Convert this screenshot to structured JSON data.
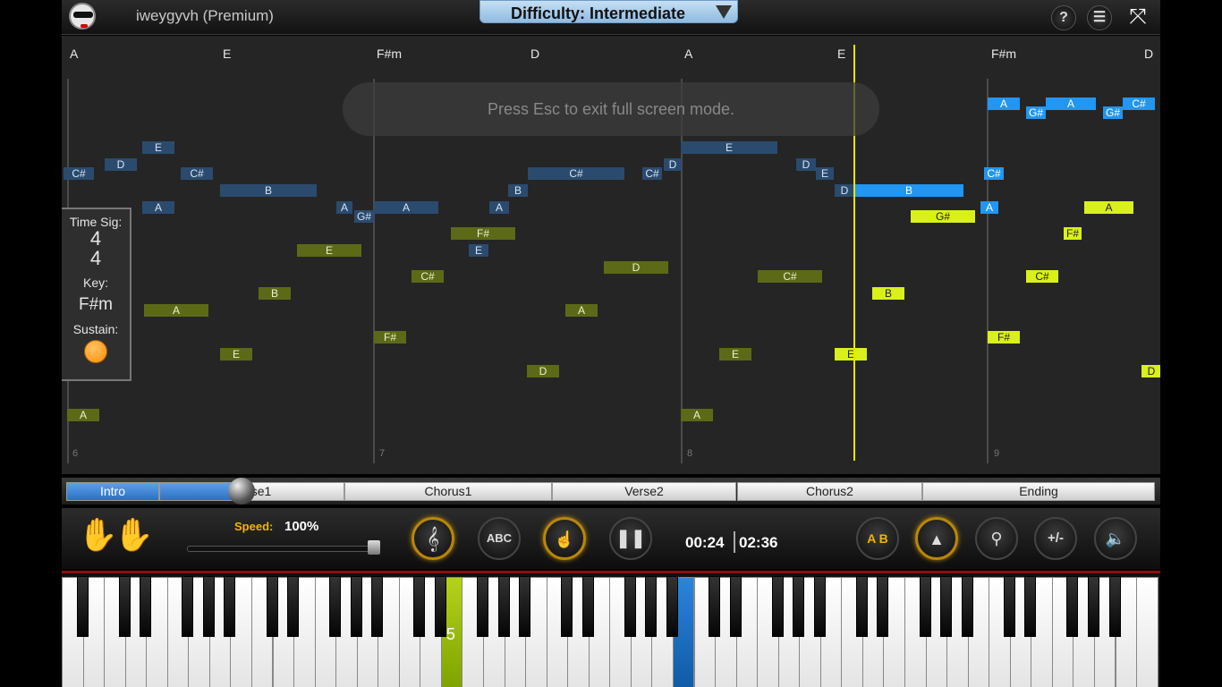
{
  "header": {
    "username": "iweygyvh (Premium)",
    "difficulty": "Difficulty: Intermediate",
    "help_label": "?"
  },
  "score": {
    "chords": [
      "A",
      "E",
      "F#m",
      "D",
      "A",
      "E",
      "F#m",
      "D"
    ],
    "bar_numbers": [
      "6",
      "7",
      "8",
      "9"
    ],
    "fullscreen_message": "Press Esc to exit full screen mode.",
    "notes": [
      "C#",
      "D",
      "E",
      "C#",
      "A",
      "B",
      "A",
      "G#",
      "A",
      "F#",
      "E",
      "A",
      "B",
      "C#",
      "D",
      "E",
      "C#",
      "D",
      "E",
      "D",
      "C#",
      "B",
      "G#",
      "A",
      "C#",
      "A",
      "G#",
      "A",
      "G#",
      "A",
      "F#",
      "C#",
      "B",
      "E",
      "D",
      "E",
      "A",
      "A",
      "E",
      "D",
      "F#",
      "E",
      "A",
      "B",
      "C#",
      "E",
      "D",
      "F#"
    ]
  },
  "info_panel": {
    "time_sig_label": "Time Sig:",
    "time_sig_top": "4",
    "time_sig_bottom": "4",
    "key_label": "Key:",
    "key_value": "F#m",
    "sustain_label": "Sustain:"
  },
  "sections": {
    "items": [
      "Intro",
      "Verse1",
      "Chorus1",
      "Verse2",
      "Chorus2",
      "Ending"
    ],
    "progress_fraction": 0.16
  },
  "controls": {
    "speed_label": "Speed:",
    "speed_value": "100%",
    "speed_fraction": 1.0,
    "abc_label": "ABC",
    "ab_label": "A B",
    "plusminus_label": "+/-",
    "time_elapsed": "00:24",
    "time_total": "02:36"
  },
  "keyboard": {
    "finger_label": "5"
  },
  "colors": {
    "left_hand_dim": "#5c6a17",
    "left_hand_active": "#d9f01a",
    "right_hand_dim": "#2b4b6e",
    "right_hand_active": "#2196f3",
    "playhead": "#e6e600",
    "sustain": "#ff8c00"
  }
}
